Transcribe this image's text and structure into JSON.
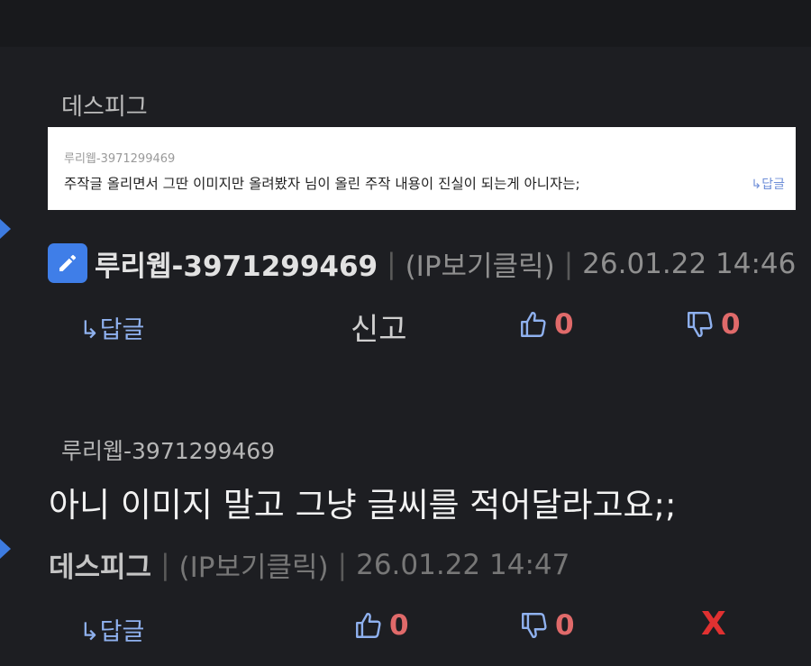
{
  "comment1": {
    "reply_to": "데스피그",
    "quote": {
      "author": "루리웹-3971299469",
      "text": "주작글 올리면서 그딴 이미지만 올려봤자 님이 올린 주작 내용이 진실이 되는게 아니자는;",
      "reply_label": "↳답글"
    },
    "author": "루리웹-3971299469",
    "ip_label": "(IP보기클릭)",
    "timestamp": "26.01.22 14:46",
    "separator": "|",
    "reply_label": "↳답글",
    "report_label": "신고",
    "upvotes": "0",
    "downvotes": "0"
  },
  "comment2": {
    "reply_to": "루리웹-3971299469",
    "text": "아니 이미지 말고 그냥 글씨를 적어달라고요;;",
    "author": "데스피그",
    "ip_label": "(IP보기클릭)",
    "timestamp": "26.01.22 14:47",
    "separator": "|",
    "reply_label": "↳답글",
    "upvotes": "0",
    "downvotes": "0",
    "delete_label": "X"
  },
  "icons": {
    "edit": "pencil-icon",
    "up": "thumbs-up-icon",
    "down": "thumbs-down-icon",
    "marker": "triangle-marker-icon"
  },
  "colors": {
    "background": "#1d1e22",
    "accent": "#3f7ee8",
    "vote_count": "#e06a6a",
    "delete": "#e03131"
  }
}
